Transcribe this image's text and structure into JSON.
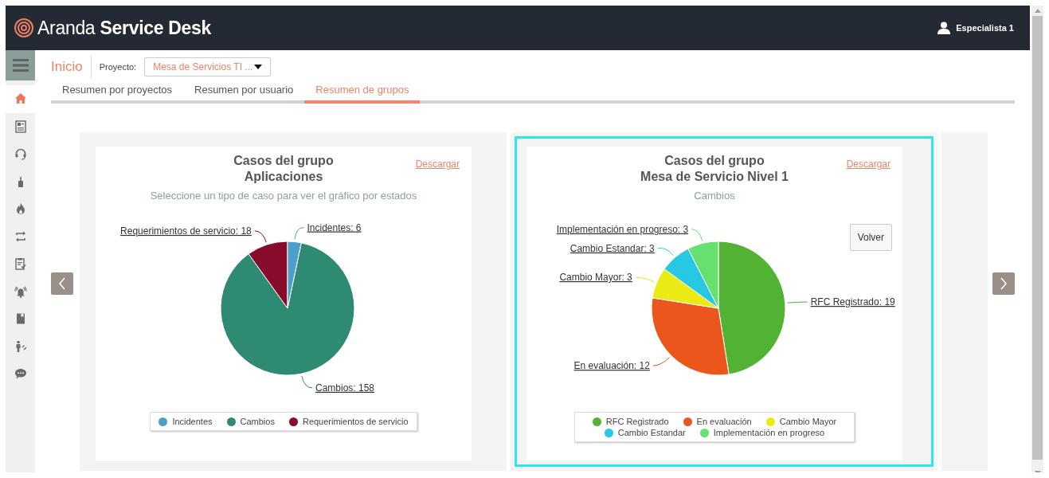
{
  "header": {
    "brand": "Aranda **Service Desk**",
    "user": "Especialista 1"
  },
  "sidebar": {
    "items": [
      {
        "selected": true
      },
      {
        "selected": false
      },
      {
        "selected": false
      },
      {
        "selected": false
      },
      {
        "selected": false
      },
      {
        "selected": false
      },
      {
        "selected": false
      },
      {
        "selected": false
      },
      {
        "selected": false
      },
      {
        "selected": false
      },
      {
        "selected": false
      }
    ]
  },
  "breadcrumb": {
    "title": "Inicio",
    "project_label": "Proyecto:",
    "project_value": "Mesa de Servicios TI ..."
  },
  "tabs": [
    {
      "label": "Resumen por proyectos",
      "selected": false
    },
    {
      "label": "Resumen por usuario",
      "selected": false
    },
    {
      "label": "Resumen de grupos",
      "selected": true
    }
  ],
  "panels": [
    {
      "selected": false,
      "kind": "chart",
      "heading": "Casos del grupo",
      "group": "Aplicaciones",
      "subtitle": "Seleccione un tipo de caso para ver el gráfico por estados",
      "download": "Descargar",
      "chart_data": {
        "type": "pie",
        "categories": [
          "Incidentes",
          "Cambios",
          "Requerimientos de servicio"
        ],
        "values": [
          6,
          158,
          18
        ],
        "colors": [
          "#4d9fcb",
          "#2f8a73",
          "#870c2b"
        ],
        "value_labels": [
          "Incidentes: 6",
          "Cambios: 158",
          "Requerimientos de servicio: 18"
        ]
      }
    },
    {
      "selected": true,
      "kind": "chart",
      "heading": "Casos del grupo",
      "group": "Mesa de Servicio Nivel 1",
      "subtitle": "Cambios",
      "download": "Descargar",
      "back_button": "Volver",
      "chart_data": {
        "type": "pie",
        "categories": [
          "RFC Registrado",
          "En evaluación",
          "Cambio Mayor",
          "Cambio Estandar",
          "Implementación en progreso"
        ],
        "values": [
          19,
          12,
          3,
          3,
          3
        ],
        "colors": [
          "#52b234",
          "#ea561c",
          "#ebea14",
          "#27c8e2",
          "#66e170"
        ],
        "value_labels": [
          "RFC Registrado: 19",
          "En evaluación: 12",
          "Cambio Mayor: 3",
          "Cambio Estandar: 3",
          "Implementación en progreso: 3"
        ]
      }
    },
    {
      "selected": false,
      "kind": "empty"
    }
  ]
}
